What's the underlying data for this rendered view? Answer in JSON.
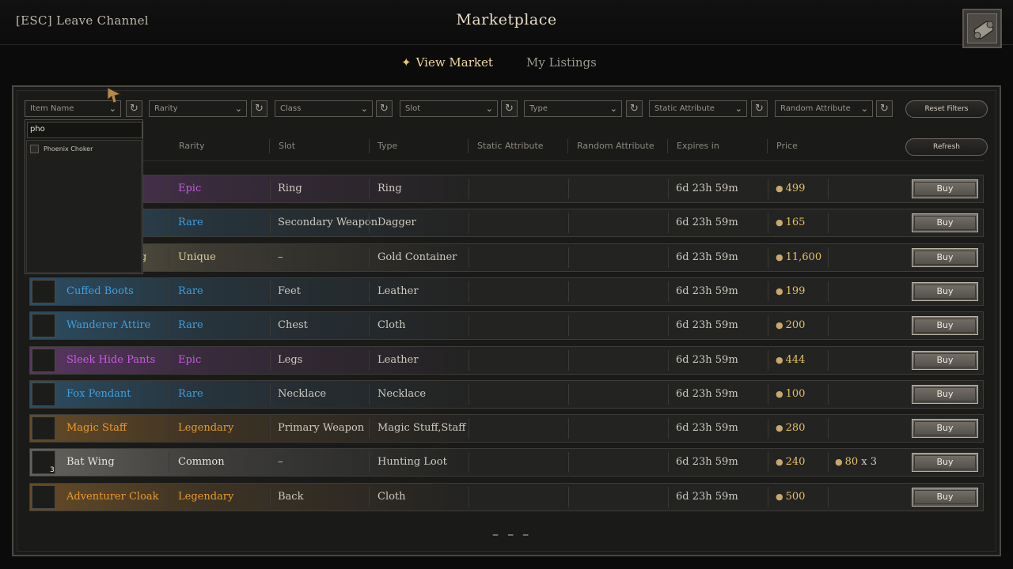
{
  "header": {
    "leave_label": "[ESC] Leave Channel",
    "title": "Marketplace",
    "corner_icon": "scroll-icon"
  },
  "tabs": [
    {
      "label": "View Market",
      "active": true
    },
    {
      "label": "My Listings",
      "active": false
    }
  ],
  "filters": {
    "item_name": "Item Name",
    "rarity": "Rarity",
    "class": "Class",
    "slot": "Slot",
    "type": "Type",
    "static_attribute": "Static Attribute",
    "random_attribute": "Random Attribute",
    "reset_label": "Reset Filters",
    "refresh_label": "Refresh"
  },
  "columns": {
    "rarity": "Rarity",
    "slot": "Slot",
    "type": "Type",
    "static_attribute": "Static Attribute",
    "random_attribute": "Random Attribute",
    "expires": "Expires in",
    "price": "Price"
  },
  "search": {
    "value": "pho",
    "options": [
      "Phoenix Choker"
    ]
  },
  "rows": [
    {
      "name": "",
      "rarity": "Epic",
      "slot": "Ring",
      "type": "Ring",
      "expires": "6d 23h 59m",
      "price": "499",
      "color": "#c45de0"
    },
    {
      "name": "",
      "rarity": "Rare",
      "slot": "Secondary Weapon",
      "type": "Dagger",
      "expires": "6d 23h 59m",
      "price": "165",
      "color": "#3f9fe0"
    },
    {
      "name": "g",
      "rarity": "Unique",
      "slot": "–",
      "type": "Gold Container",
      "expires": "6d 23h 59m",
      "price": "11,600",
      "color": "#e0cf9a"
    },
    {
      "name": "Cuffed Boots",
      "rarity": "Rare",
      "slot": "Feet",
      "type": "Leather",
      "expires": "6d 23h 59m",
      "price": "199",
      "color": "#3f9fe0"
    },
    {
      "name": "Wanderer Attire",
      "rarity": "Rare",
      "slot": "Chest",
      "type": "Cloth",
      "expires": "6d 23h 59m",
      "price": "200",
      "color": "#3f9fe0"
    },
    {
      "name": "Sleek Hide Pants",
      "rarity": "Epic",
      "slot": "Legs",
      "type": "Leather",
      "expires": "6d 23h 59m",
      "price": "444",
      "color": "#c45de0"
    },
    {
      "name": "Fox Pendant",
      "rarity": "Rare",
      "slot": "Necklace",
      "type": "Necklace",
      "expires": "6d 23h 59m",
      "price": "100",
      "color": "#3f9fe0"
    },
    {
      "name": "Magic Staff",
      "rarity": "Legendary",
      "slot": "Primary Weapon",
      "type": "Magic Stuff,Staff",
      "expires": "6d 23h 59m",
      "price": "280",
      "color": "#e89a30"
    },
    {
      "name": "Bat Wing",
      "rarity": "Common",
      "slot": "–",
      "type": "Hunting Loot",
      "expires": "6d 23h 59m",
      "price": "240",
      "unit_price": "80",
      "qty": "x 3",
      "stack": "3",
      "color": "#e8e4dc"
    },
    {
      "name": "Adventurer Cloak",
      "rarity": "Legendary",
      "slot": "Back",
      "type": "Cloth",
      "expires": "6d 23h 59m",
      "price": "500",
      "color": "#e89a30"
    }
  ],
  "buy_label": "Buy",
  "pagination": "– – –"
}
